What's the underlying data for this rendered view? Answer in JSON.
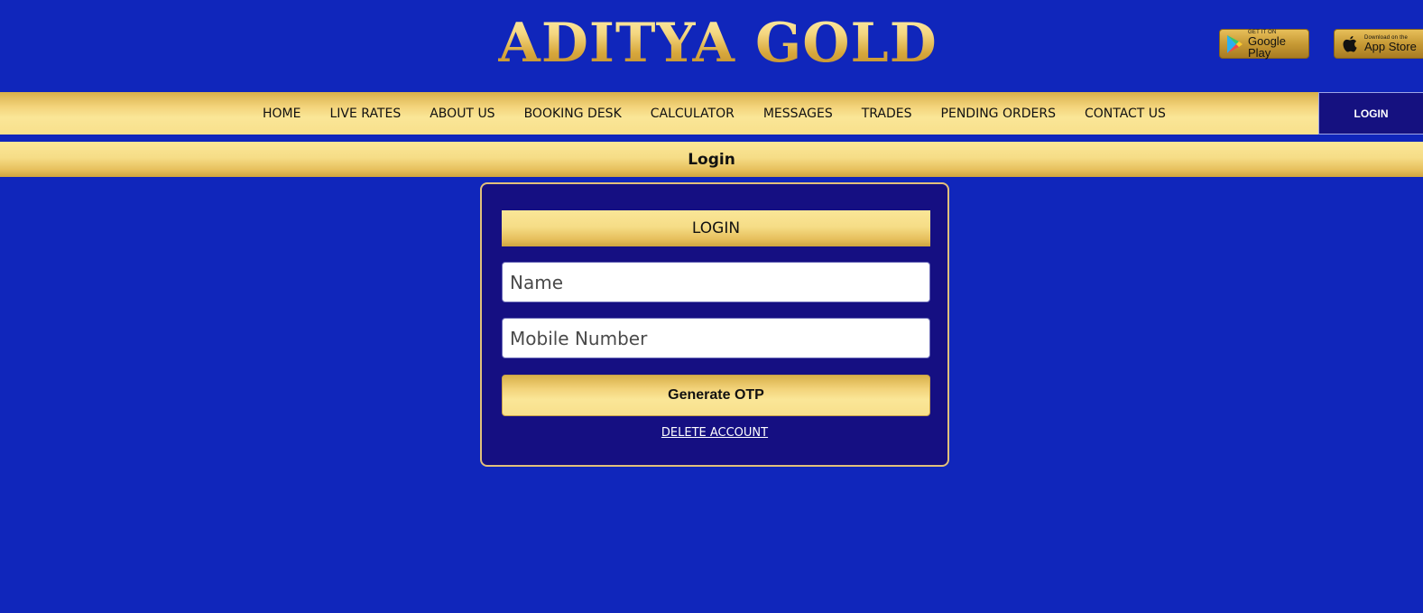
{
  "header": {
    "logo_text": "ADITYA GOLD",
    "google_play": {
      "small": "GET IT ON",
      "big": "Google Play",
      "icon": "google-play-icon"
    },
    "app_store": {
      "small": "Download on the",
      "big": "App Store",
      "icon": "apple-icon"
    }
  },
  "nav": {
    "items": [
      {
        "label": "HOME"
      },
      {
        "label": "LIVE RATES"
      },
      {
        "label": "ABOUT US"
      },
      {
        "label": "BOOKING DESK"
      },
      {
        "label": "CALCULATOR"
      },
      {
        "label": "MESSAGES"
      },
      {
        "label": "TRADES"
      },
      {
        "label": "PENDING ORDERS"
      },
      {
        "label": "CONTACT US"
      }
    ],
    "login_label": "LOGIN"
  },
  "page": {
    "title": "Login"
  },
  "login_form": {
    "header": "LOGIN",
    "name_placeholder": "Name",
    "name_value": "",
    "mobile_placeholder": "Mobile Number",
    "mobile_value": "",
    "otp_button": "Generate OTP",
    "delete_account": "DELETE ACCOUNT"
  },
  "colors": {
    "background": "#1026bb",
    "card_bg": "#150f82",
    "gold": "#f6dd87",
    "card_border": "#e2c07a"
  }
}
